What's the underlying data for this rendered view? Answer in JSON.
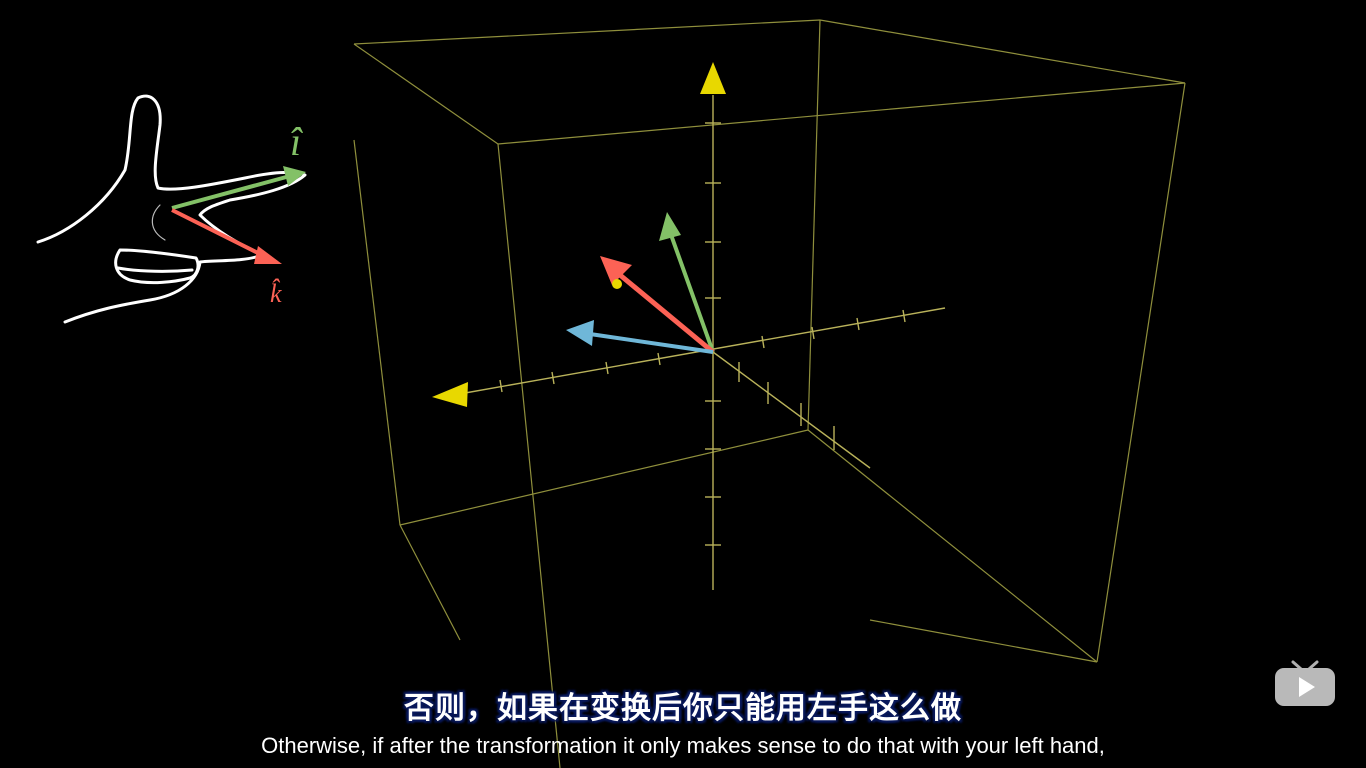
{
  "video": {
    "subtitle_cn": "否则，如果在变换后你只能用左手这么做",
    "subtitle_en": "Otherwise, if after the transformation it only makes sense to do that with your left hand,"
  },
  "hand_diagram": {
    "label_i": "î",
    "label_k": "k̂"
  },
  "colors": {
    "background": "#000000",
    "box_edges": "#8f8f3c",
    "axis": "#b9b25a",
    "axis_tip": "#e8d800",
    "i_hat": "#83c167",
    "j_hat": "#fc6255",
    "k_hat": "#6fb7d8",
    "subtitle_outline": "#0a1a5e"
  },
  "player": {
    "watermark_icon": "tv-play-icon"
  }
}
